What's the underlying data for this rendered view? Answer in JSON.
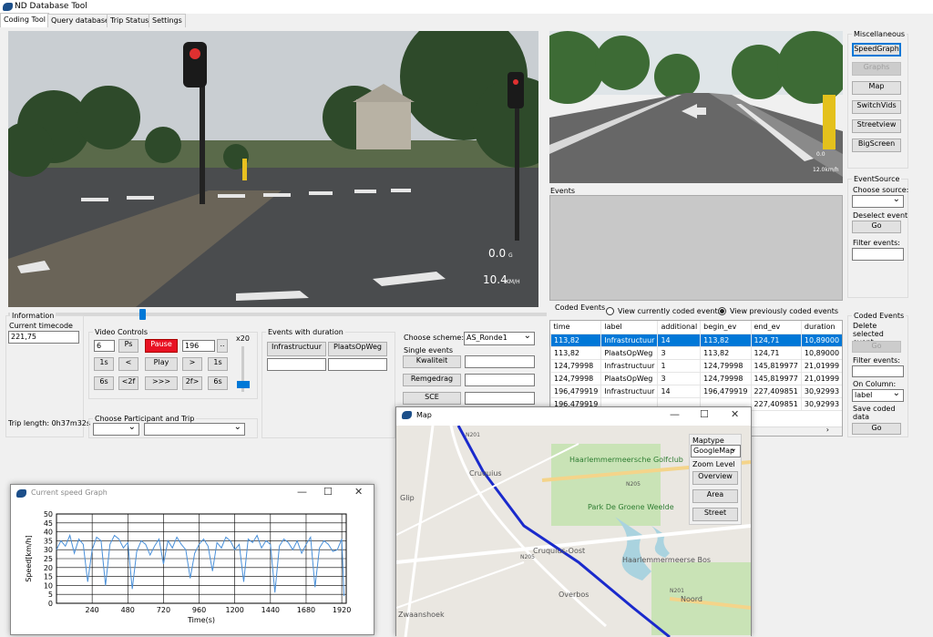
{
  "app": {
    "title": "ND Database Tool"
  },
  "tabs": [
    {
      "label": "Coding Tool"
    },
    {
      "label": "Query database"
    },
    {
      "label": "Trip Status"
    },
    {
      "label": "Settings"
    }
  ],
  "video_main": {
    "speed1": "0.0",
    "speed1_unit": "G",
    "speed2": "10.4",
    "speed2_unit": "KM/H",
    "seek_fraction": 0.25
  },
  "video_side": {
    "val1": "0.0",
    "val2": "12.0km/h"
  },
  "misc": {
    "title": "Miscellaneous",
    "buttons": [
      "SpeedGraph",
      "Graphs",
      "Map",
      "SwitchVids",
      "Streetview",
      "BigScreen"
    ]
  },
  "eventsource": {
    "title": "EventSource",
    "choose_label": "Choose source:",
    "deselect_label": "Deselect event",
    "go": "Go",
    "filter_label": "Filter events:"
  },
  "events_panel": {
    "label": "Events"
  },
  "info": {
    "title": "Information",
    "timecode_label": "Current timecode",
    "timecode": "221,75",
    "trip_length": "Trip length: 0h37m32s"
  },
  "video_controls": {
    "title": "Video Controls",
    "step": "6",
    "ps": "Ps",
    "pause": "Pause",
    "frame": "196",
    "dots": "..",
    "speed": "x20",
    "b1": "1s",
    "b2": "<",
    "play": "Play",
    "b4": ">",
    "b5": "1s",
    "b6": "6s",
    "b7": "<2f",
    "b8": ">>>",
    "b9": "2f>",
    "b10": "6s"
  },
  "participant": {
    "title": "Choose Participant and Trip"
  },
  "events_duration": {
    "title": "Events with duration",
    "b1": "Infrastructuur",
    "b2": "PlaatsOpWeg"
  },
  "scheme": {
    "label": "Choose scheme:",
    "value": "AS_Ronde1",
    "single_label": "Single events",
    "buttons": [
      "Kwaliteit",
      "Remgedrag",
      "SCE"
    ]
  },
  "coded": {
    "title": "Coded Events",
    "radio1": "View currently coded events",
    "radio2": "View previously coded events",
    "columns": [
      "time",
      "label",
      "additional",
      "begin_ev",
      "end_ev",
      "duration"
    ],
    "rows": [
      [
        "113,82",
        "Infrastructuur",
        "14",
        "113,82",
        "124,71",
        "10,89000"
      ],
      [
        "113,82",
        "PlaatsOpWeg",
        "3",
        "113,82",
        "124,71",
        "10,89000"
      ],
      [
        "124,79998",
        "Infrastructuur",
        "1",
        "124,79998",
        "145,819977",
        "21,01999"
      ],
      [
        "124,79998",
        "PlaatsOpWeg",
        "3",
        "124,79998",
        "145,819977",
        "21,01999"
      ],
      [
        "196,479919",
        "Infrastructuur",
        "14",
        "196,479919",
        "227,409851",
        "30,92993"
      ],
      [
        "196,479919",
        "",
        "",
        "",
        "227,409851",
        "30,92993"
      ]
    ]
  },
  "coded_side": {
    "title": "Coded Events",
    "delete_label": "Delete selected event",
    "go": "Go",
    "filter_label": "Filter events:",
    "column_label": "On Column:",
    "column_value": "label",
    "save_label": "Save coded data",
    "save_go": "Go"
  },
  "map_window": {
    "title": "Map",
    "maptype_label": "Maptype",
    "maptype_value": "GoogleMap",
    "zoom_label": "Zoom Level",
    "buttons": [
      "Overview",
      "Area",
      "Street"
    ],
    "places": [
      "Haarlemmermeersche Golfclub",
      "Cruquius",
      "Park De Groene Weelde",
      "Cruquius-Oost",
      "Haarlemmermeerse Bos",
      "Overbos",
      "Noord",
      "Zwaanshoek",
      "Glip",
      "N205",
      "N201",
      "N205",
      "N201"
    ]
  },
  "speed_window": {
    "title": "Current speed Graph"
  },
  "chart_data": {
    "type": "line",
    "title": "",
    "xlabel": "Time(s)",
    "ylabel": "Speed[km/h]",
    "xlim": [
      0,
      1950
    ],
    "ylim": [
      0,
      50
    ],
    "xticks": [
      240,
      480,
      720,
      960,
      1200,
      1440,
      1680,
      1920
    ],
    "yticks": [
      0,
      5,
      10,
      15,
      20,
      25,
      30,
      35,
      40,
      45,
      50
    ],
    "grid": true,
    "series": [
      {
        "color": "#4a90d9",
        "x": [
          0,
          30,
          60,
          90,
          120,
          150,
          180,
          210,
          240,
          270,
          300,
          330,
          360,
          390,
          420,
          450,
          480,
          510,
          540,
          570,
          600,
          630,
          660,
          690,
          720,
          750,
          780,
          810,
          840,
          870,
          900,
          930,
          960,
          990,
          1020,
          1050,
          1080,
          1110,
          1140,
          1170,
          1200,
          1230,
          1260,
          1290,
          1320,
          1350,
          1380,
          1410,
          1440,
          1470,
          1500,
          1530,
          1560,
          1590,
          1620,
          1650,
          1680,
          1710,
          1740,
          1770,
          1800,
          1830,
          1860,
          1890,
          1920,
          1935
        ],
        "y": [
          30,
          35,
          32,
          38,
          28,
          36,
          33,
          12,
          30,
          37,
          35,
          10,
          33,
          38,
          36,
          31,
          34,
          8,
          29,
          35,
          33,
          27,
          32,
          36,
          22,
          35,
          31,
          37,
          33,
          30,
          14,
          28,
          33,
          36,
          32,
          18,
          34,
          31,
          37,
          35,
          30,
          33,
          12,
          36,
          34,
          38,
          31,
          35,
          33,
          6,
          32,
          36,
          34,
          30,
          35,
          28,
          33,
          37,
          9,
          31,
          35,
          33,
          29,
          30,
          36,
          4
        ]
      }
    ]
  }
}
